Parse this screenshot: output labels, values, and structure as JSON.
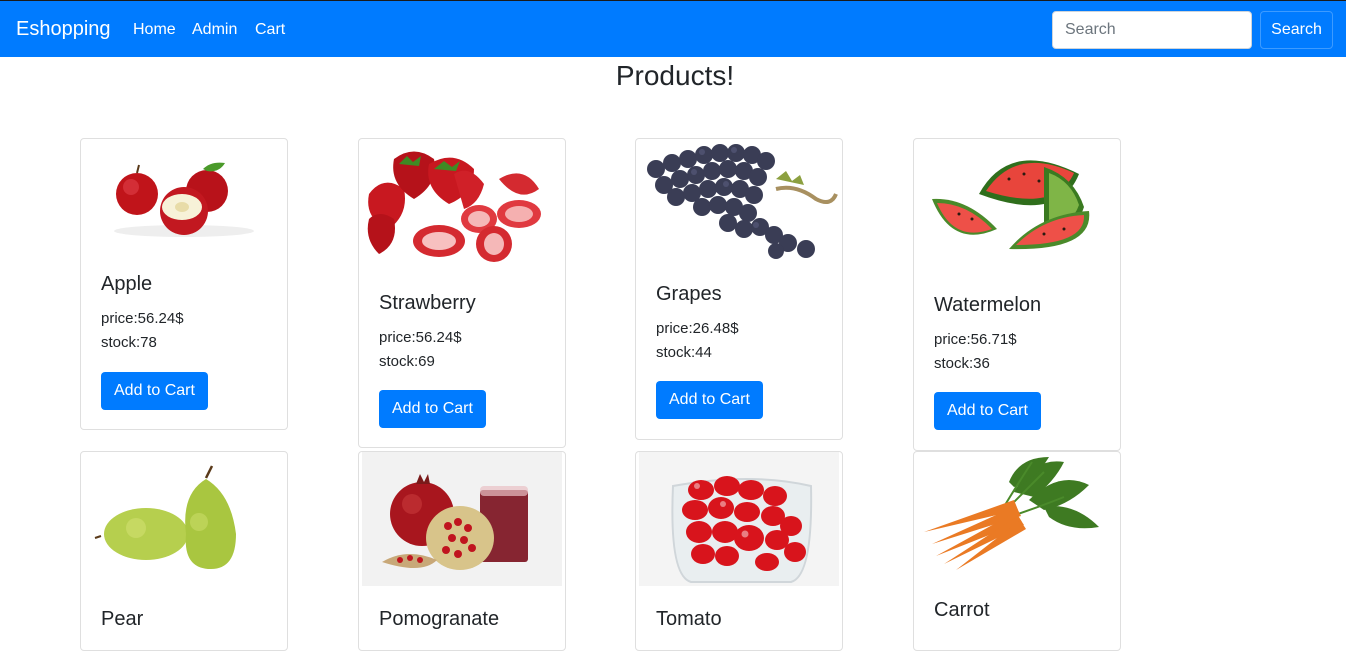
{
  "navbar": {
    "brand": "Eshopping",
    "links": [
      "Home",
      "Admin",
      "Cart"
    ],
    "search_placeholder": "Search",
    "search_button": "Search",
    "bg_color": "#007bff"
  },
  "page": {
    "title": "Products!"
  },
  "products": [
    {
      "name": "Apple",
      "price": "price:56.24$",
      "stock": "stock:78",
      "button": "Add to Cart",
      "icon": "apple-image"
    },
    {
      "name": "Strawberry",
      "price": "price:56.24$",
      "stock": "stock:69",
      "button": "Add to Cart",
      "icon": "strawberry-image"
    },
    {
      "name": "Grapes",
      "price": "price:26.48$",
      "stock": "stock:44",
      "button": "Add to Cart",
      "icon": "grapes-image"
    },
    {
      "name": "Watermelon",
      "price": "price:56.71$",
      "stock": "stock:36",
      "button": "Add to Cart",
      "icon": "watermelon-image"
    },
    {
      "name": "Pear",
      "icon": "pear-image"
    },
    {
      "name": "Pomogranate",
      "icon": "pomegranate-image"
    },
    {
      "name": "Tomato",
      "icon": "tomato-image"
    },
    {
      "name": "Carrot",
      "icon": "carrot-image"
    }
  ]
}
